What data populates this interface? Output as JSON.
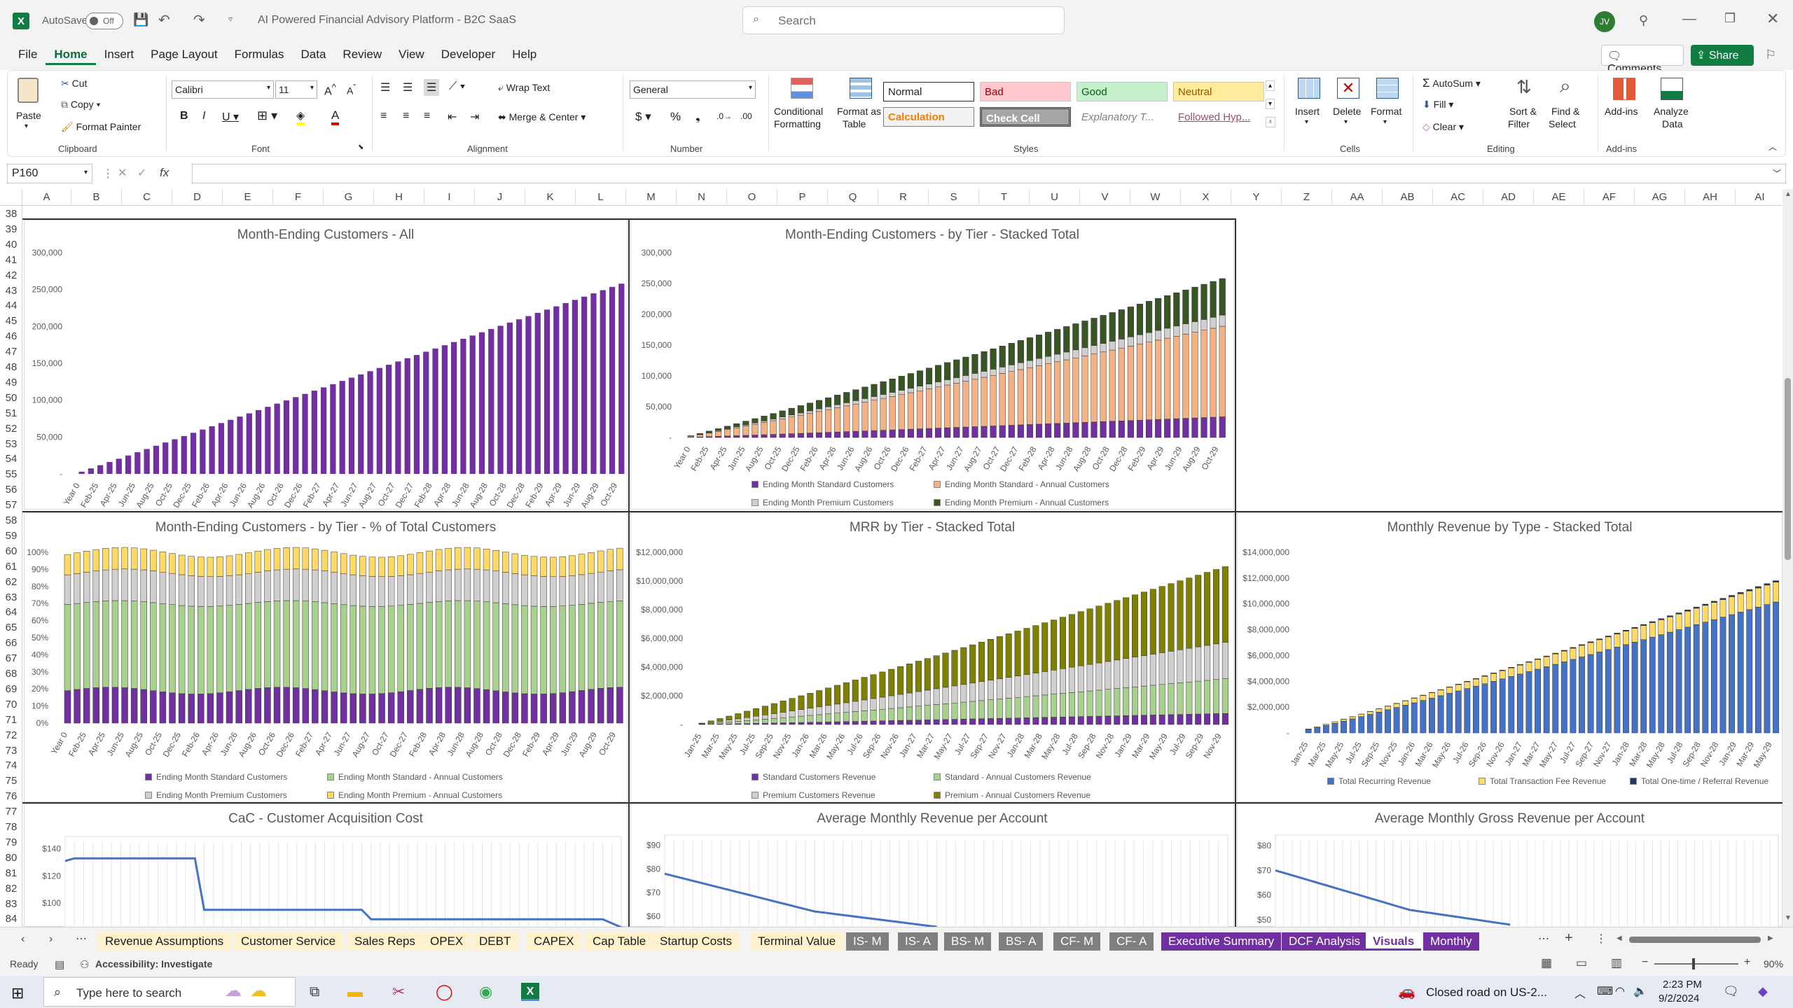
{
  "titlebar": {
    "autosave_label": "AutoSave",
    "autosave_state": "Off",
    "doc_title": "AI Powered Financial Advisory Platform - B2C SaaS",
    "search_placeholder": "Search",
    "avatar_initials": "JV"
  },
  "menu": [
    "File",
    "Home",
    "Insert",
    "Page Layout",
    "Formulas",
    "Data",
    "Review",
    "View",
    "Developer",
    "Help"
  ],
  "menu_right": {
    "comments": "Comments",
    "share": "Share"
  },
  "ribbon": {
    "clipboard": {
      "paste": "Paste",
      "cut": "Cut",
      "copy": "Copy",
      "format_painter": "Format Painter",
      "label": "Clipboard"
    },
    "font": {
      "name": "Calibri",
      "size": "11",
      "label": "Font"
    },
    "alignment": {
      "wrap": "Wrap Text",
      "merge": "Merge & Center",
      "label": "Alignment"
    },
    "number": {
      "format": "General",
      "label": "Number"
    },
    "styles": {
      "cond1": "Conditional",
      "cond2": "Formatting",
      "fmt1": "Format as",
      "fmt2": "Table",
      "normal": "Normal",
      "bad": "Bad",
      "good": "Good",
      "neutral": "Neutral",
      "calculation": "Calculation",
      "check": "Check Cell",
      "explanatory": "Explanatory T...",
      "followed": "Followed Hyp...",
      "label": "Styles"
    },
    "cells": {
      "insert": "Insert",
      "delete": "Delete",
      "format": "Format",
      "label": "Cells"
    },
    "editing": {
      "autosum": "AutoSum",
      "fill": "Fill",
      "clear": "Clear",
      "sort1": "Sort &",
      "sort2": "Filter",
      "find1": "Find &",
      "find2": "Select",
      "label": "Editing"
    },
    "addins": {
      "addins": "Add-ins",
      "analyze1": "Analyze",
      "analyze2": "Data",
      "label": "Add-ins"
    }
  },
  "formula_bar": {
    "name_box": "P160",
    "fx": "fx",
    "formula": ""
  },
  "columns": [
    "A",
    "B",
    "C",
    "D",
    "E",
    "F",
    "G",
    "H",
    "I",
    "J",
    "K",
    "L",
    "M",
    "N",
    "O",
    "P",
    "Q",
    "R",
    "S",
    "T",
    "U",
    "V",
    "W",
    "X",
    "Y",
    "Z",
    "AA",
    "AB",
    "AC",
    "AD",
    "AE",
    "AF",
    "AG",
    "AH",
    "AI"
  ],
  "rows": [
    "38",
    "39",
    "40",
    "41",
    "42",
    "43",
    "44",
    "45",
    "46",
    "47",
    "48",
    "49",
    "50",
    "51",
    "52",
    "53",
    "54",
    "55",
    "56",
    "57",
    "58",
    "59",
    "60",
    "61",
    "62",
    "63",
    "64",
    "65",
    "66",
    "67",
    "68",
    "69",
    "70",
    "71",
    "72",
    "73",
    "74",
    "75",
    "76",
    "77",
    "78",
    "79",
    "80",
    "81",
    "82",
    "83",
    "84"
  ],
  "colors": {
    "purple": "#7030a0",
    "salmon": "#f4b183",
    "gray": "#d0cece",
    "darkgreen": "#375623",
    "olive": "#a9d18e",
    "yellow": "#ffd966",
    "olive_dark": "#7f7f00",
    "blue": "#4472c4",
    "line": "#4472c4",
    "excel_green": "#107c41"
  },
  "chart_data": [
    {
      "type": "bar",
      "title": "Month-Ending Customers - All",
      "ylim": [
        0,
        300000
      ],
      "yticks": [
        "300,000",
        "250,000",
        "200,000",
        "150,000",
        "100,000",
        "50,000",
        "-"
      ],
      "categories": [
        "Year 0",
        "Feb-25",
        "Apr-25",
        "Jun-25",
        "Aug-25",
        "Oct-25",
        "Dec-25",
        "Feb-26",
        "Apr-26",
        "Jun-26",
        "Aug-26",
        "Oct-26",
        "Dec-26",
        "Feb-27",
        "Apr-27",
        "Jun-27",
        "Aug-27",
        "Oct-27",
        "Dec-27",
        "Feb-28",
        "Apr-28",
        "Jun-28",
        "Aug-28",
        "Oct-28",
        "Dec-28",
        "Feb-29",
        "Apr-29",
        "Jun-29",
        "Aug-29",
        "Oct-29"
      ],
      "series": [
        {
          "values_start": 3000,
          "values_end": 258000,
          "count": 59
        }
      ]
    },
    {
      "type": "bar",
      "stacked": true,
      "title": "Month-Ending Customers - by Tier - Stacked Total",
      "ylim": [
        0,
        300000
      ],
      "yticks": [
        "300,000",
        "250,000",
        "200,000",
        "150,000",
        "100,000",
        "50,000",
        "-"
      ],
      "categories": [
        "Year 0",
        "Feb-25",
        "Apr-25",
        "Jun-25",
        "Aug-25",
        "Oct-25",
        "Dec-25",
        "Feb-26",
        "Apr-26",
        "Jun-26",
        "Aug-26",
        "Oct-26",
        "Dec-26",
        "Feb-27",
        "Apr-27",
        "Jun-27",
        "Aug-27",
        "Oct-27",
        "Dec-27",
        "Feb-28",
        "Apr-28",
        "Jun-28",
        "Aug-28",
        "Oct-28",
        "Dec-28",
        "Feb-29",
        "Apr-29",
        "Jun-29",
        "Aug-29",
        "Oct-29"
      ],
      "series": [
        {
          "name": "Ending Month Standard Customers",
          "share": 0.13
        },
        {
          "name": "Ending Month Standard - Annual Customers",
          "share": 0.57
        },
        {
          "name": "Ending Month Premium Customers",
          "share": 0.07
        },
        {
          "name": "Ending Month Premium - Annual Customers",
          "share": 0.23
        }
      ],
      "total_start": 3000,
      "total_end": 258000
    },
    {
      "type": "bar",
      "stacked_percent": true,
      "title": "Month-Ending Customers - by Tier - % of Total Customers",
      "yticks": [
        "100%",
        "90%",
        "80%",
        "70%",
        "60%",
        "50%",
        "40%",
        "30%",
        "20%",
        "10%",
        "0%"
      ],
      "categories": [
        "Year 0",
        "Feb-25",
        "Apr-25",
        "Jun-25",
        "Aug-25",
        "Oct-25",
        "Dec-25",
        "Feb-26",
        "Apr-26",
        "Jun-26",
        "Aug-26",
        "Oct-26",
        "Dec-26",
        "Feb-27",
        "Apr-27",
        "Jun-27",
        "Aug-27",
        "Oct-27",
        "Dec-27",
        "Feb-28",
        "Apr-28",
        "Jun-28",
        "Aug-28",
        "Oct-28",
        "Dec-28",
        "Feb-29",
        "Apr-29",
        "Jun-29",
        "Aug-29",
        "Oct-29"
      ],
      "series": [
        {
          "name": "Ending Month Standard Customers",
          "share": 0.19
        },
        {
          "name": "Ending Month Standard - Annual Customers",
          "share": 0.51
        },
        {
          "name": "Ending Month Premium Customers",
          "share": 0.18
        },
        {
          "name": "Ending Month Premium - Annual Customers",
          "share": 0.12
        }
      ]
    },
    {
      "type": "bar",
      "stacked": true,
      "title": "MRR by Tier - Stacked Total",
      "ylim": [
        0,
        12000000
      ],
      "yticks": [
        "$12,000,000",
        "$10,000,000",
        "$8,000,000",
        "$6,000,000",
        "$4,000,000",
        "$2,000,000",
        "-"
      ],
      "categories": [
        "Jan-25",
        "Mar-25",
        "May-25",
        "Jul-25",
        "Sep-25",
        "Nov-25",
        "Jan-26",
        "Mar-26",
        "May-26",
        "Jul-26",
        "Sep-26",
        "Nov-26",
        "Jan-27",
        "Mar-27",
        "May-27",
        "Jul-27",
        "Sep-27",
        "Nov-27",
        "Jan-28",
        "Mar-28",
        "May-28",
        "Jul-28",
        "Sep-28",
        "Nov-28",
        "Jan-29",
        "Mar-29",
        "May-29",
        "Jul-29",
        "Sep-29",
        "Nov-29"
      ],
      "series": [
        {
          "name": "Standard Customers Revenue",
          "share": 0.07
        },
        {
          "name": "Standard - Annual Customers Revenue",
          "share": 0.22
        },
        {
          "name": "Premium Customers Revenue",
          "share": 0.23
        },
        {
          "name": "Premium - Annual Customers Revenue",
          "share": 0.48
        }
      ],
      "total_start": 100000,
      "total_end": 11000000
    },
    {
      "type": "bar",
      "stacked": true,
      "title": "Monthly Revenue by Type - Stacked Total",
      "ylim": [
        0,
        14000000
      ],
      "yticks": [
        "$14,000,000",
        "$12,000,000",
        "$10,000,000",
        "$8,000,000",
        "$6,000,000",
        "$4,000,000",
        "$2,000,000",
        "-"
      ],
      "categories": [
        "Jan-25",
        "Mar-25",
        "May-25",
        "Jul-25",
        "Sep-25",
        "Nov-25",
        "Jan-26",
        "Mar-26",
        "May-26",
        "Jul-26",
        "Sep-26",
        "Nov-26",
        "Jan-27",
        "Mar-27",
        "May-27",
        "Jul-27",
        "Sep-27",
        "Nov-27",
        "Jan-28",
        "Mar-28",
        "May-28",
        "Jul-28",
        "Sep-28",
        "Nov-28",
        "Jan-29",
        "Mar-29",
        "May-29"
      ],
      "series": [
        {
          "name": "Total Recurring Revenue",
          "share": 0.86
        },
        {
          "name": "Total Transaction Fee Revenue",
          "share": 0.13
        },
        {
          "name": "Total One-time / Referral Revenue",
          "share": 0.01
        }
      ],
      "total_start": 300000,
      "total_end": 11800000
    },
    {
      "type": "line",
      "title": "CaC - Customer Acquisition Cost",
      "yticks": [
        "$140",
        "$120",
        "$100"
      ],
      "ylim": [
        85,
        145
      ],
      "values": [
        131,
        133,
        133,
        133,
        133,
        133,
        133,
        133,
        133,
        133,
        133,
        133,
        133,
        133,
        133,
        95,
        95,
        95,
        95,
        95,
        95,
        95,
        95,
        95,
        95,
        95,
        95,
        95,
        95,
        95,
        95,
        95,
        95,
        88,
        88,
        88,
        88,
        88,
        88,
        88,
        88,
        88,
        88,
        88,
        88,
        88,
        88,
        88,
        88,
        88,
        88,
        88,
        88,
        88,
        88,
        88,
        88,
        88,
        88,
        85,
        82,
        80,
        78
      ]
    },
    {
      "type": "line",
      "title": "Average Monthly Revenue per Account",
      "yticks": [
        "$90",
        "$80",
        "$70",
        "$60"
      ],
      "ylim": [
        57,
        92
      ],
      "values": [
        78,
        77,
        76,
        75,
        74,
        73,
        72,
        71,
        70,
        69,
        68,
        67,
        66,
        65,
        64,
        63,
        62,
        61.5,
        61,
        60.5,
        60,
        59.5,
        59,
        58.5,
        58,
        57.5,
        57,
        56.5,
        56,
        55.5
      ]
    },
    {
      "type": "line",
      "title": "Average Monthly Gross Revenue per Account",
      "yticks": [
        "$80",
        "$70",
        "$60",
        "$50"
      ],
      "ylim": [
        48,
        82
      ],
      "values": [
        70,
        69,
        68,
        67,
        66,
        65,
        64,
        63,
        62,
        61,
        60,
        59,
        58,
        57,
        56,
        55,
        54,
        53.5,
        53,
        52.5,
        52,
        51.5,
        51,
        50.5,
        50,
        49.5,
        49,
        48.5,
        48
      ]
    }
  ],
  "sheet_tabs": [
    {
      "label": "Revenue Assumptions",
      "style": "yellow"
    },
    {
      "label": "Customer Service",
      "style": "yellow"
    },
    {
      "label": "Sales Reps",
      "style": "yellow"
    },
    {
      "label": "OPEX",
      "style": "yellow"
    },
    {
      "label": "DEBT",
      "style": "yellow"
    },
    {
      "label": "CAPEX",
      "style": "yellow"
    },
    {
      "label": "Cap Table",
      "style": "yellow"
    },
    {
      "label": "Startup Costs",
      "style": "yellow"
    },
    {
      "label": "Terminal Value",
      "style": "yellow"
    },
    {
      "label": "IS- M",
      "style": "gray"
    },
    {
      "label": "IS- A",
      "style": "gray"
    },
    {
      "label": "BS- M",
      "style": "gray"
    },
    {
      "label": "BS- A",
      "style": "gray"
    },
    {
      "label": "CF- M",
      "style": "gray"
    },
    {
      "label": "CF- A",
      "style": "gray"
    },
    {
      "label": "Executive Summary",
      "style": "purple"
    },
    {
      "label": "DCF Analysis",
      "style": "purple"
    },
    {
      "label": "Visuals",
      "style": "active"
    },
    {
      "label": "Monthly",
      "style": "purple"
    }
  ],
  "status": {
    "ready": "Ready",
    "accessibility": "Accessibility: Investigate",
    "zoom": "90%"
  },
  "taskbar": {
    "search_placeholder": "Type here to search",
    "news": "Closed road on US-2...",
    "time": "2:23 PM",
    "date": "9/2/2024"
  }
}
